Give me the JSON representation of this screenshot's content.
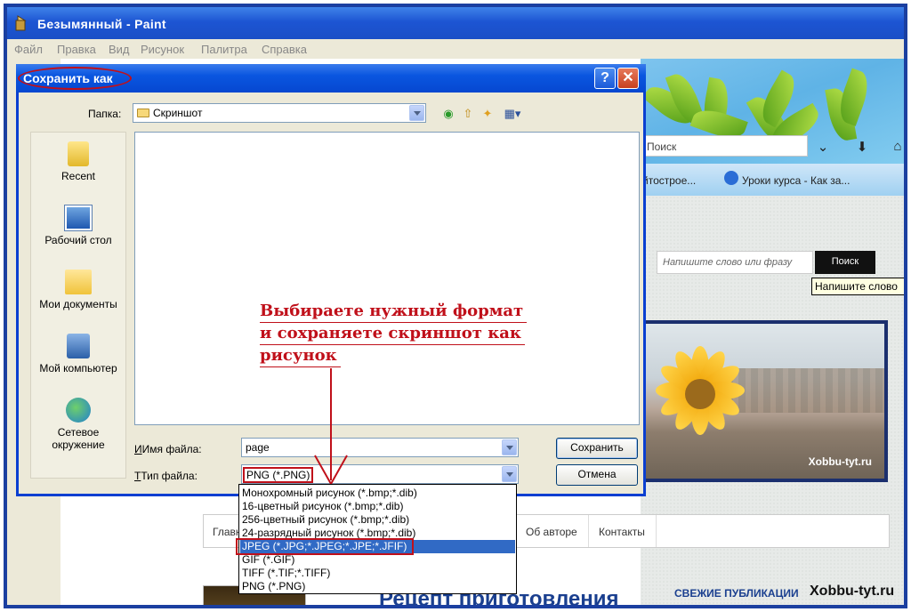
{
  "paint": {
    "title": "Безымянный - Paint",
    "menu": [
      "Файл",
      "Правка",
      "Вид",
      "Рисунок",
      "Палитра",
      "Справка"
    ]
  },
  "dialog": {
    "title": "Сохранить как",
    "folder_label": "Папка:",
    "folder_value": "Скриншот",
    "places": [
      "Recent",
      "Рабочий стол",
      "Мои документы",
      "Мой компьютер",
      "Сетевое окружение"
    ],
    "filename_label": "Имя файла:",
    "filename_value": "page",
    "filetype_label": "Тип файла:",
    "filetype_value": "PNG (*.PNG)",
    "save_button": "Сохранить",
    "cancel_button": "Отмена",
    "help_button": "?",
    "close_button": "✕",
    "filetype_options": [
      "Монохромный рисунок (*.bmp;*.dib)",
      "16-цветный рисунок (*.bmp;*.dib)",
      "256-цветный рисунок (*.bmp;*.dib)",
      "24-разрядный рисунок (*.bmp;*.dib)",
      "JPEG (*.JPG;*.JPEG;*.JPE;*.JFIF)",
      "GIF (*.GIF)",
      "TIFF (*.TIF;*.TIFF)",
      "PNG (*.PNG)"
    ],
    "highlighted_option": "JPEG (*.JPG;*.JPEG;*.JPE;*.JFIF)"
  },
  "annotation": {
    "lines": [
      "Выбираете нужный формат",
      "и сохраняете скриншот как",
      "рисунок"
    ],
    "color": "#c0101a"
  },
  "background_page": {
    "browser_search_placeholder": "Поиск",
    "tab1": "йтострое...",
    "tab2": "Уроки курса - Как за...",
    "site_search_placeholder": "Напишите слово или фразу",
    "site_search_button": "Поиск",
    "tooltip": "Напишите слово",
    "photo_watermark": "Xobbu-tyt.ru",
    "nav": [
      "Главн",
      "Об авторе",
      "Контакты"
    ],
    "recipe_title": "Рецепт приготовления",
    "fresh_label": "СВЕЖИЕ ПУБЛИКАЦИИ",
    "brand": "Xobbu-tyt.ru"
  },
  "colors": {
    "frame": "#1b3fa0",
    "xp_title": "#0a56e0",
    "highlight": "#316ac5",
    "accent_red": "#c0101a"
  }
}
